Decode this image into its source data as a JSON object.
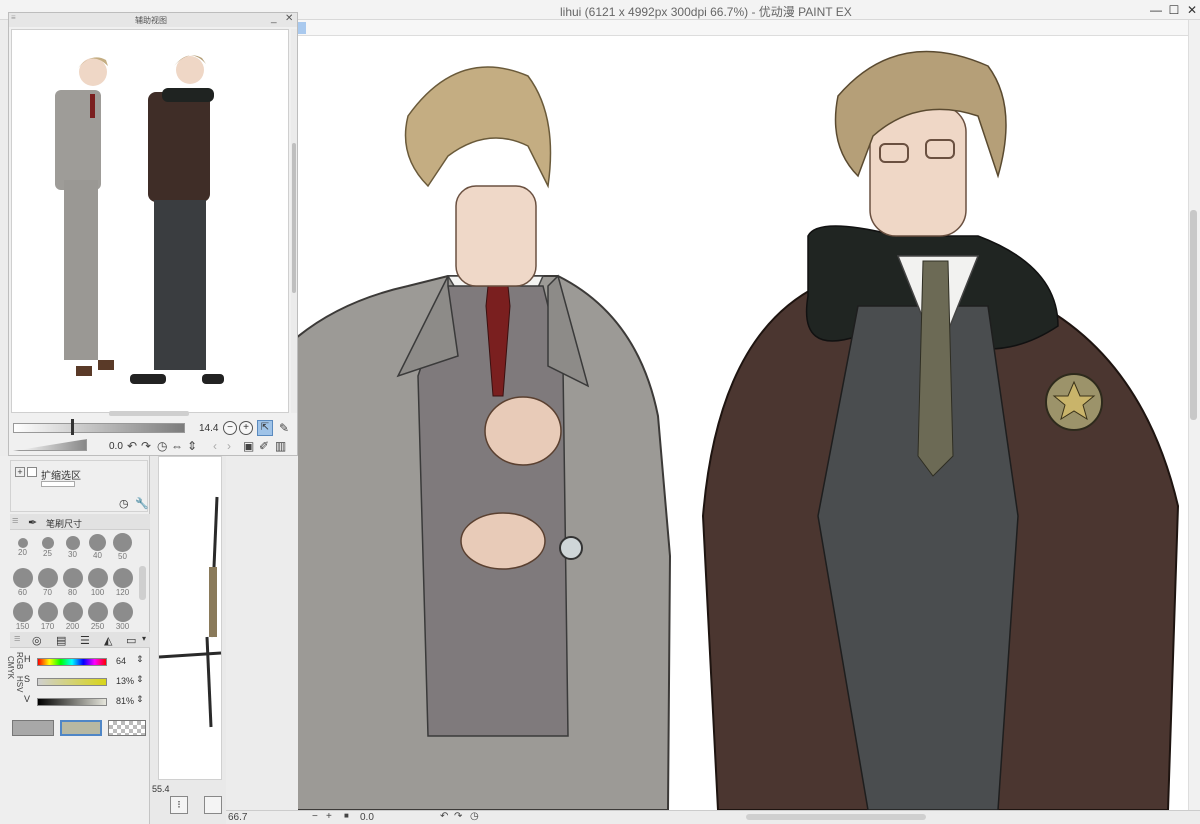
{
  "window": {
    "title": "lihui (6121 x 4992px 300dpi 66.7%)  - 优动漫 PAINT EX",
    "min_label": "—",
    "max_label": "☐",
    "close_label": "✕"
  },
  "navigator": {
    "title": "辅助视图",
    "zoom_value": "14.4",
    "rotate_value": "0.0"
  },
  "selection_palette": {
    "option_label": "扩缩选区"
  },
  "brush_size": {
    "tab_label": "笔刷尺寸",
    "sizes": [
      "20",
      "25",
      "30",
      "40",
      "50",
      "60",
      "70",
      "80",
      "100",
      "120",
      "150",
      "170",
      "200",
      "250",
      "300"
    ]
  },
  "color": {
    "mode_labels": [
      "RGB",
      "HSV",
      "CMYK"
    ],
    "h_label": "H",
    "h_value": "64",
    "s_label": "S",
    "s_value": "13%",
    "v_label": "V",
    "v_value": "81%",
    "main_color": "#b7b8a2",
    "sub_color": "#a8a8a8"
  },
  "mid_panel": {
    "zoom_value": "55.4"
  },
  "statusbar": {
    "zoom_value": "66.7",
    "rotate_value": "0.0"
  },
  "colors": {
    "selected_tool": "#9fc3e8"
  }
}
